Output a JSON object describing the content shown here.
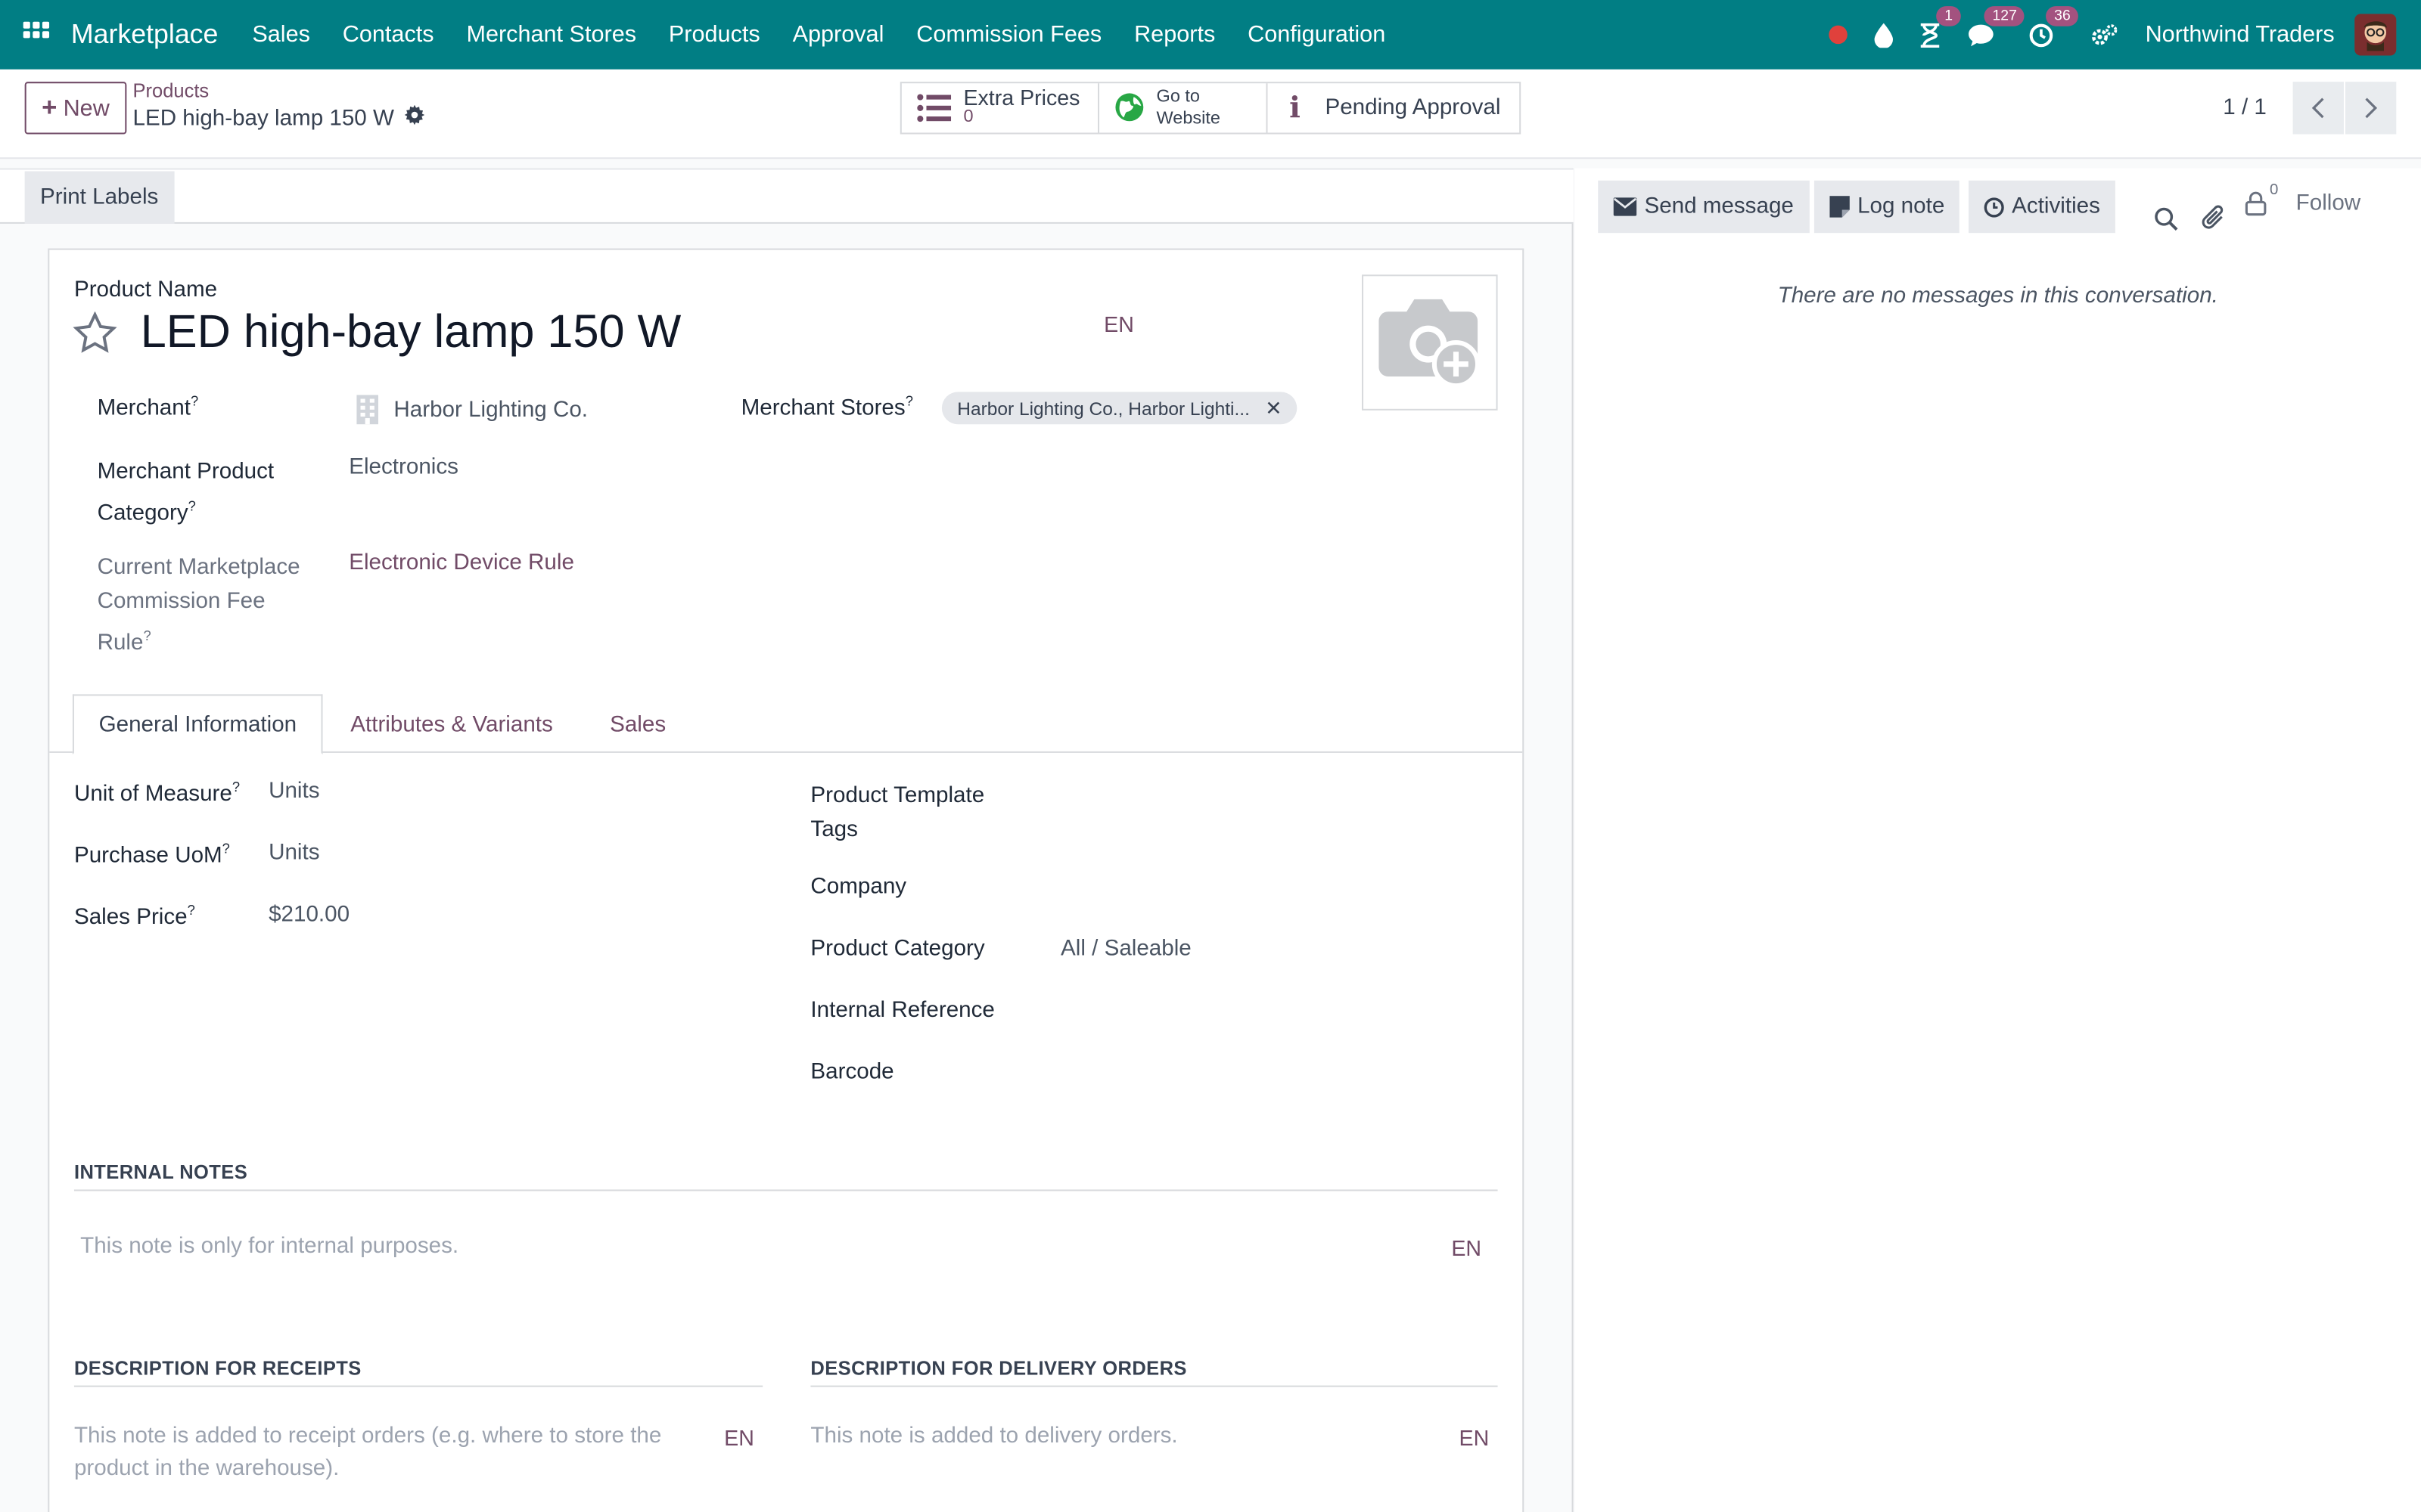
{
  "navbar": {
    "brand": "Marketplace",
    "menu": [
      "Sales",
      "Contacts",
      "Merchant Stores",
      "Products",
      "Approval",
      "Commission Fees",
      "Reports",
      "Configuration"
    ],
    "badges": {
      "activities": "1",
      "messages": "127",
      "clock": "36"
    },
    "company": "Northwind Traders"
  },
  "control": {
    "new_label": "New",
    "breadcrumb": "Products",
    "record_name": "LED high-bay lamp 150 W",
    "smart_buttons": {
      "extra_prices_label": "Extra Prices",
      "extra_prices_count": "0",
      "website_line1": "Go to",
      "website_line2": "Website",
      "approval_label": "Pending Approval"
    },
    "pager": "1 / 1"
  },
  "form": {
    "print_labels": "Print Labels",
    "product_name_label": "Product Name",
    "product_name": "LED high-bay lamp 150 W",
    "lang": "EN",
    "merchant_label": "Merchant",
    "merchant_value": "Harbor Lighting Co.",
    "merchant_stores_label": "Merchant Stores",
    "merchant_stores_tag": "Harbor Lighting Co., Harbor Lighti...",
    "merchant_category_label_1": "Merchant Product",
    "merchant_category_label_2": "Category",
    "merchant_category_value": "Electronics",
    "commission_label_1": "Current Marketplace",
    "commission_label_2": "Commission Fee",
    "commission_label_3": "Rule",
    "commission_value": "Electronic Device Rule",
    "tabs": [
      "General Information",
      "Attributes & Variants",
      "Sales"
    ],
    "uom_label": "Unit of Measure",
    "uom_value": "Units",
    "purchase_uom_label": "Purchase UoM",
    "purchase_uom_value": "Units",
    "sales_price_label": "Sales Price",
    "sales_price_value": "$210.00",
    "template_tags_label_1": "Product Template",
    "template_tags_label_2": "Tags",
    "company_label": "Company",
    "product_category_label": "Product Category",
    "product_category_value": "All / Saleable",
    "internal_reference_label": "Internal Reference",
    "barcode_label": "Barcode",
    "internal_notes_title": "INTERNAL NOTES",
    "internal_notes_placeholder": "This note is only for internal purposes.",
    "receipts_title": "DESCRIPTION FOR RECEIPTS",
    "receipts_placeholder_1": "This note is added to receipt orders (e.g. where to store the",
    "receipts_placeholder_2": "product in the warehouse).",
    "delivery_title": "DESCRIPTION FOR DELIVERY ORDERS",
    "delivery_placeholder": "This note is added to delivery orders."
  },
  "chatter": {
    "send_message": "Send message",
    "log_note": "Log note",
    "activities": "Activities",
    "followers_count": "0",
    "follow": "Follow",
    "no_messages": "There are no messages in this conversation."
  },
  "colors": {
    "navbar": "#017e84",
    "primary": "#714b67",
    "badge": "#a3527f",
    "record_dot": "#e0413c"
  }
}
